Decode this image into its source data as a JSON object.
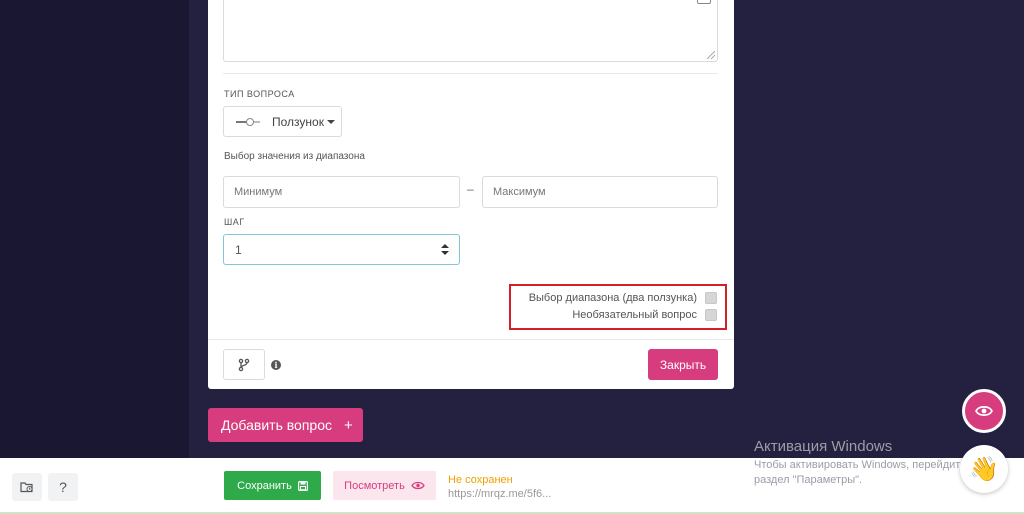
{
  "question_form": {
    "type_label": "ТИП ВОПРОСА",
    "type_value": "Ползунок",
    "range_label": "Выбор значения из диапазона",
    "min_placeholder": "Минимум",
    "range_separator": "–",
    "max_placeholder": "Максимум",
    "step_label": "ШАГ",
    "step_value": "1",
    "options": [
      {
        "label": "Выбор диапазона (два ползунка)",
        "checked": false
      },
      {
        "label": "Необязательный вопрос",
        "checked": false
      }
    ],
    "close_label": "Закрыть"
  },
  "add_question": {
    "label": "Добавить вопрос",
    "plus": "+"
  },
  "bottom_bar": {
    "help": "?",
    "save_label": "Сохранить",
    "view_label": "Посмотреть",
    "status": "Не сохранен",
    "url": "https://mrqz.me/5f6..."
  },
  "windows_activation": {
    "title": "Активация Windows",
    "line1": "Чтобы активировать Windows, перейдите в",
    "line2": "раздел \"Параметры\"."
  },
  "icons": {
    "slider": "slider-icon",
    "branch": "branch-icon",
    "info": "info-icon",
    "floppy": "floppy-icon",
    "eye": "eye-icon",
    "wave": "waving-hand-icon",
    "folder": "folder-clock-icon"
  },
  "colors": {
    "background": "#23213f",
    "accent_pink": "#d63c7e",
    "save_green": "#2faa4a",
    "highlight_red": "#d41f27",
    "status_orange": "#f0a000"
  }
}
